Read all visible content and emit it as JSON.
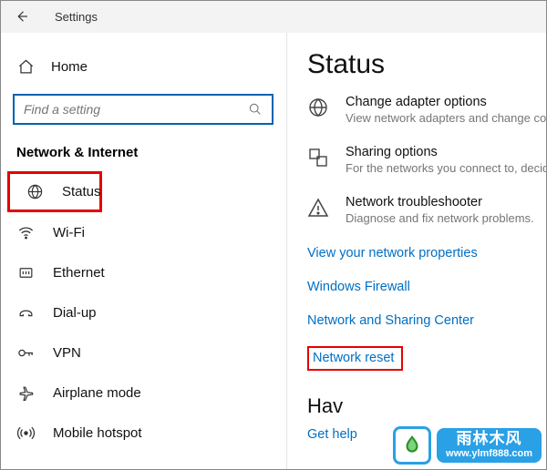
{
  "titlebar": {
    "title": "Settings"
  },
  "sidebar": {
    "home": "Home",
    "search_placeholder": "Find a setting",
    "section": "Network & Internet",
    "items": [
      {
        "label": "Status"
      },
      {
        "label": "Wi-Fi"
      },
      {
        "label": "Ethernet"
      },
      {
        "label": "Dial-up"
      },
      {
        "label": "VPN"
      },
      {
        "label": "Airplane mode"
      },
      {
        "label": "Mobile hotspot"
      }
    ]
  },
  "main": {
    "heading": "Status",
    "options": [
      {
        "title": "Change adapter options",
        "desc": "View network adapters and change connection settings."
      },
      {
        "title": "Sharing options",
        "desc": "For the networks you connect to, decide what you want to share."
      },
      {
        "title": "Network troubleshooter",
        "desc": "Diagnose and fix network problems."
      }
    ],
    "links": [
      "View your network properties",
      "Windows Firewall",
      "Network and Sharing Center",
      "Network reset"
    ],
    "question_heading": "Hav",
    "get_help": "Get help"
  },
  "watermark": {
    "cn": "雨林木风",
    "url": "www.ylmf888.com"
  }
}
